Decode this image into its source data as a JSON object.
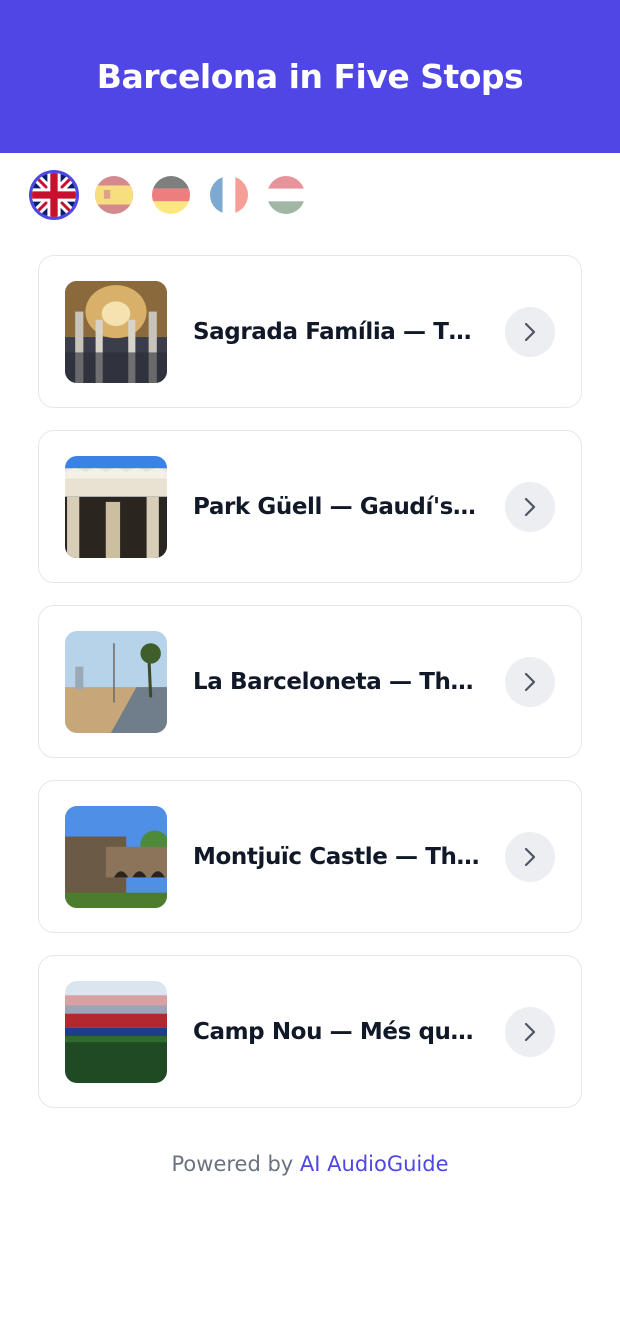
{
  "header": {
    "title": "Barcelona in Five Stops"
  },
  "languages": [
    {
      "code": "en",
      "icon": "uk-flag-icon",
      "active": true
    },
    {
      "code": "es",
      "icon": "spain-flag-icon",
      "active": false
    },
    {
      "code": "de",
      "icon": "germany-flag-icon",
      "active": false
    },
    {
      "code": "fr",
      "icon": "france-flag-icon",
      "active": false
    },
    {
      "code": "hu",
      "icon": "hungary-flag-icon",
      "active": false
    }
  ],
  "stops": [
    {
      "title": "Sagrada Família — Th…"
    },
    {
      "title": "Park Güell — Gaudí's G…"
    },
    {
      "title": "La Barceloneta — The …"
    },
    {
      "title": "Montjuïc Castle — The…"
    },
    {
      "title": "Camp Nou — Més que …"
    }
  ],
  "footer": {
    "prefix": "Powered by",
    "brand": "AI AudioGuide"
  },
  "colors": {
    "accent": "#4f46e5",
    "card_border": "#e5e7eb",
    "chevron_bg": "#eceef1"
  }
}
